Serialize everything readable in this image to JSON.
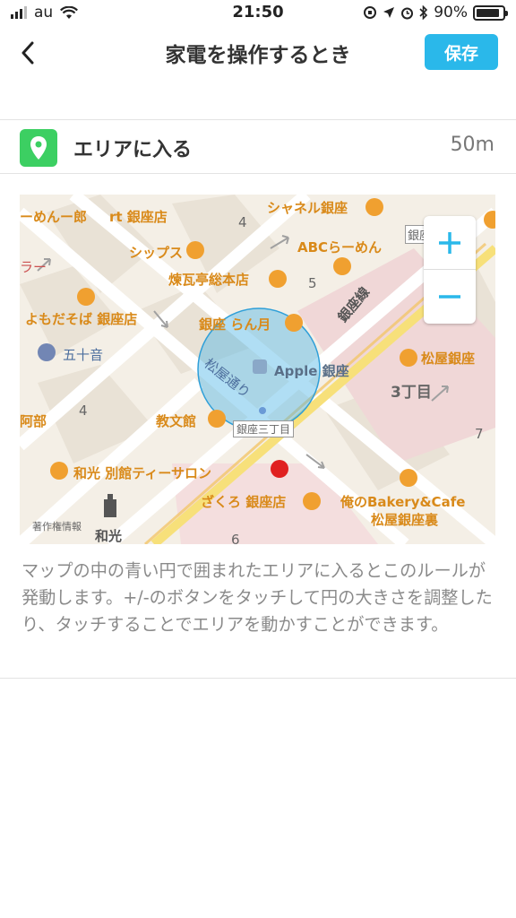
{
  "status_bar": {
    "carrier": "au",
    "time": "21:50",
    "battery": "90%",
    "battery_level": 0.9
  },
  "nav": {
    "title": "家電を操作するとき",
    "save_label": "保存",
    "back_icon": "chevron-left-icon"
  },
  "trigger": {
    "icon": "location-pin-icon",
    "label": "エリアに入る",
    "radius": "50m",
    "accent": "#3ccf62"
  },
  "map": {
    "zoom_in_label": "+",
    "zoom_out_label": "−",
    "labels": [
      "ーめんー郎",
      "rt 銀座店",
      "シャネル銀座",
      "銀座",
      "シップス",
      "ABCらーめん",
      "煉瓦亭総本店",
      "よもだそば 銀座店",
      "銀座 らん月",
      "銀座線",
      "五十音",
      "松屋銀座",
      "松屋通り",
      "Apple 銀座",
      "3丁目",
      "阿部",
      "教文館",
      "銀座三丁目",
      "和光 別館ティーサロン",
      "ざくろ 銀座店",
      "俺のBakery&Cafe",
      "松屋銀座裏",
      "著作権情報",
      "和光",
      "ラー",
      "4",
      "5",
      "4",
      "6",
      "7"
    ],
    "circle_color": "#4fb6e6"
  },
  "description": "マップの中の青い円で囲まれたエリアに入るとこのルールが発動します。+/-のボタンをタッチして円の大きさを調整したり、タッチすることでエリアを動かすことができます。"
}
